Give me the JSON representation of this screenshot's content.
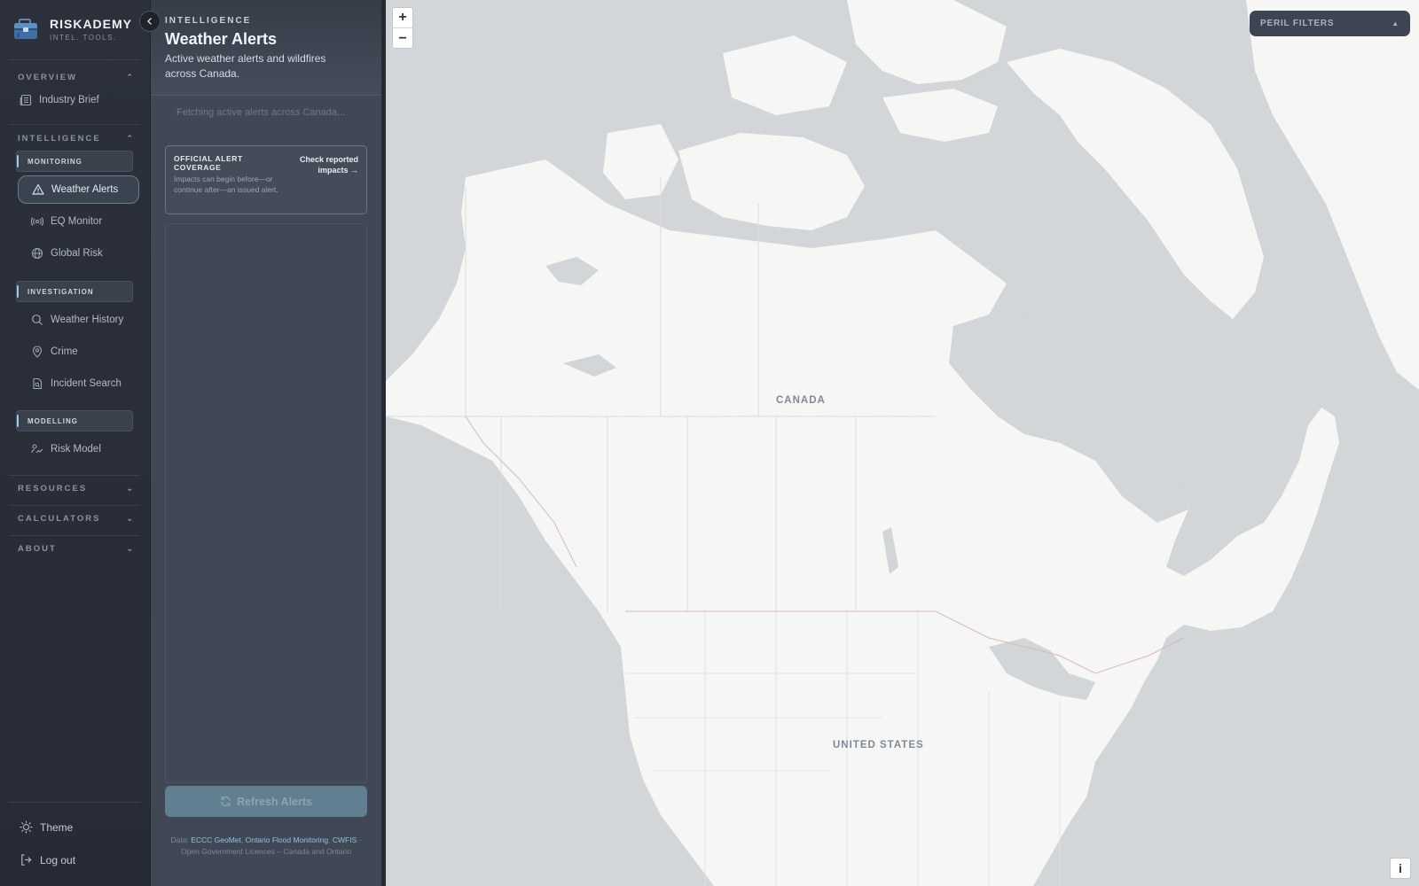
{
  "brand": {
    "name": "RISKADEMY",
    "tagline": "INTEL. TOOLS."
  },
  "sidebar": {
    "overview": {
      "label": "OVERVIEW",
      "links": {
        "industry_brief": "Industry Brief"
      }
    },
    "intelligence": {
      "label": "INTELLIGENCE",
      "monitoring": {
        "label": "MONITORING",
        "items": {
          "weather_alerts": "Weather Alerts",
          "eq_monitor": "EQ Monitor",
          "global_risk": "Global Risk"
        }
      },
      "investigation": {
        "label": "INVESTIGATION",
        "items": {
          "weather_history": "Weather History",
          "crime": "Crime",
          "incident_search": "Incident Search"
        }
      },
      "modelling": {
        "label": "MODELLING",
        "items": {
          "risk_model": "Risk Model"
        }
      }
    },
    "resources": {
      "label": "RESOURCES"
    },
    "calculators": {
      "label": "CALCULATORS"
    },
    "about": {
      "label": "ABOUT"
    },
    "bottom": {
      "theme": "Theme",
      "logout": "Log out"
    },
    "active_item": "Weather Alerts"
  },
  "panel": {
    "eyebrow": "INTELLIGENCE",
    "title": "Weather Alerts",
    "subtitle": "Active weather alerts and wildfires across Canada.",
    "loading_text": "Fetching active alerts across Canada...",
    "coverage": {
      "title": "OFFICIAL ALERT COVERAGE",
      "description": "Impacts can begin before—or continue after—an issued alert.",
      "link": "Check reported impacts →"
    },
    "refresh_label": "Refresh Alerts",
    "credit": {
      "prefix": "Data: ",
      "src1": "ECCC GeoMet",
      "sep1": ", ",
      "src2": "Ontario Flood Monitoring",
      "sep2": ", ",
      "src3": "CWFIS",
      "suffix": " · Open Government Licences – Canada and Ontario"
    }
  },
  "map": {
    "zoom_in": "+",
    "zoom_out": "−",
    "labels": {
      "canada": "CANADA",
      "united_states": "UNITED STATES"
    },
    "peril_filters": "PERIL FILTERS",
    "peril_caret": "▲",
    "info": "i",
    "colors": {
      "water": "#d2d6d9",
      "land": "#f6f6f5",
      "border": "#d9b8bd",
      "boundary": "#dcdcdc"
    }
  }
}
